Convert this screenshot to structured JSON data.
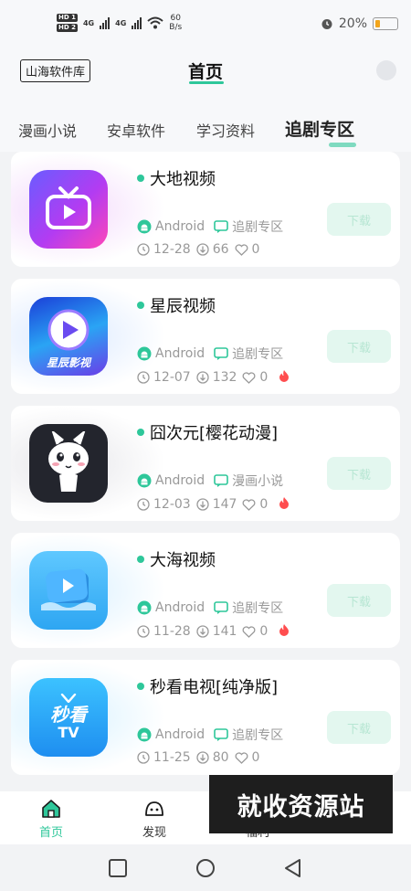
{
  "status_bar": {
    "hd1": "HD 1",
    "hd2": "HD 2",
    "net1": "4G",
    "net2": "4G",
    "speed_value": "60",
    "speed_unit": "B/s",
    "battery": "20%"
  },
  "header": {
    "logo_text": "山海软件库",
    "title": "首页"
  },
  "tabs": [
    {
      "label": "漫画小说",
      "active": false
    },
    {
      "label": "安卓软件",
      "active": false
    },
    {
      "label": "学习资料",
      "active": false
    },
    {
      "label": "追剧专区",
      "active": true
    }
  ],
  "apps": [
    {
      "name": "大地视频",
      "platform": "Android",
      "category": "追剧专区",
      "date": "12-28",
      "downloads": "66",
      "likes": "0",
      "hot": false,
      "button": "下载"
    },
    {
      "name": "星辰视频",
      "platform": "Android",
      "category": "追剧专区",
      "date": "12-07",
      "downloads": "132",
      "likes": "0",
      "hot": true,
      "icon_text": "星辰影视",
      "button": "下载"
    },
    {
      "name": "囧次元[樱花动漫]",
      "platform": "Android",
      "category": "漫画小说",
      "date": "12-03",
      "downloads": "147",
      "likes": "0",
      "hot": true,
      "button": "下载"
    },
    {
      "name": "大海视频",
      "platform": "Android",
      "category": "追剧专区",
      "date": "11-28",
      "downloads": "141",
      "likes": "0",
      "hot": true,
      "button": "下载"
    },
    {
      "name": "秒看电视[纯净版]",
      "platform": "Android",
      "category": "追剧专区",
      "date": "11-25",
      "downloads": "80",
      "likes": "0",
      "hot": false,
      "icon_text_1": "秒看",
      "icon_text_2": "TV",
      "button": "下载"
    }
  ],
  "bottom_nav": [
    {
      "label": "首页",
      "icon": "home-icon",
      "active": true
    },
    {
      "label": "发现",
      "icon": "discover-icon",
      "active": false
    },
    {
      "label": "福利",
      "icon": "gift-icon",
      "active": false
    }
  ],
  "watermark": "就收资源站",
  "colors": {
    "accent": "#2ec79a",
    "hot": "#ff4d4f"
  }
}
